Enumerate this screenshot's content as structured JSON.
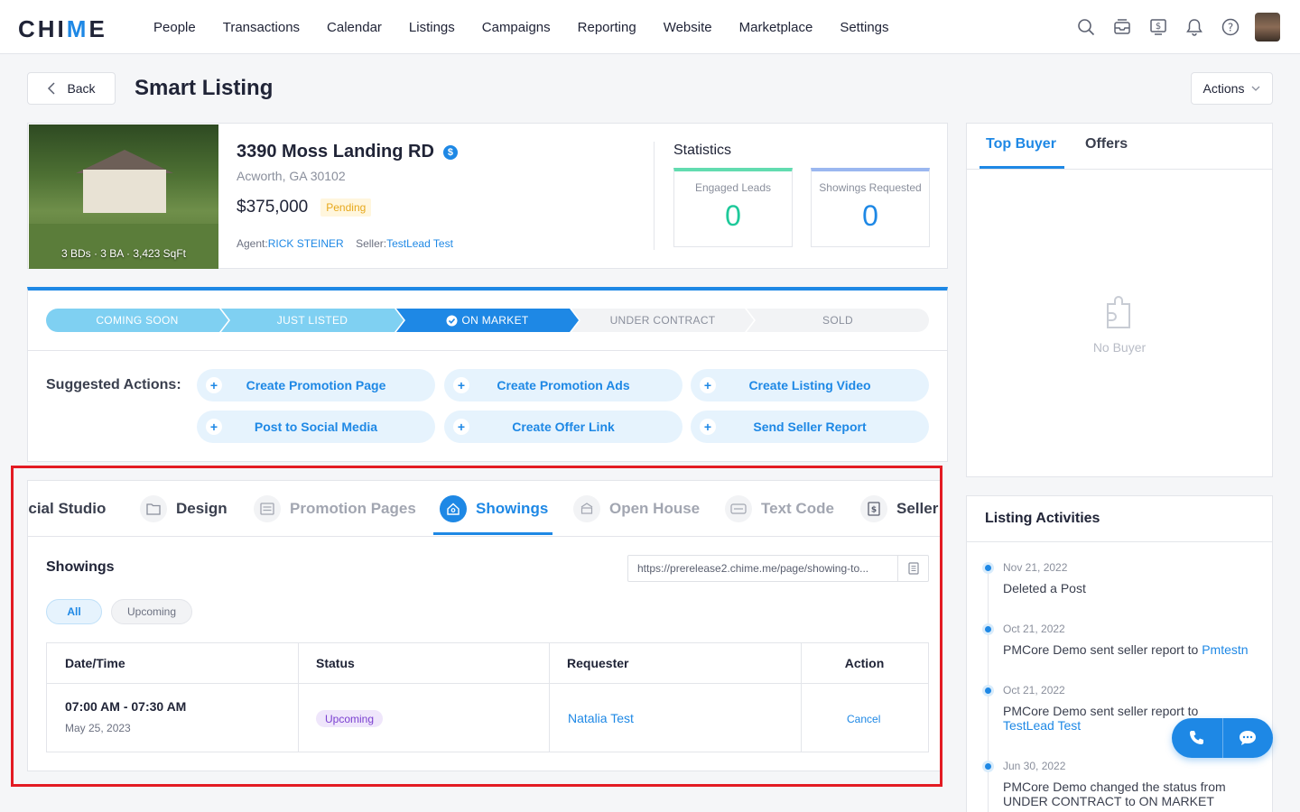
{
  "brand": {
    "logo_text_a": "CHI",
    "logo_text_b": "M",
    "logo_text_c": "E",
    "accent": "#1e88e5"
  },
  "nav": {
    "items": [
      "People",
      "Transactions",
      "Calendar",
      "Listings",
      "Campaigns",
      "Reporting",
      "Website",
      "Marketplace",
      "Settings"
    ],
    "icons": [
      "search-icon",
      "inbox-icon",
      "billing-icon",
      "bell-icon",
      "help-icon"
    ]
  },
  "header": {
    "back_label": "Back",
    "title": "Smart Listing",
    "actions_label": "Actions"
  },
  "listing": {
    "photo_caption": "3 BDs · 3 BA · 3,423 SqFt",
    "address": "3390 Moss Landing RD",
    "city": "Acworth, GA 30102",
    "price": "$375,000",
    "status": "Pending",
    "agent_label": "Agent:",
    "agent_name": "RICK STEINER",
    "seller_label": "Seller:",
    "seller_name": "TestLead Test"
  },
  "statistics": {
    "title": "Statistics",
    "engaged_label": "Engaged Leads",
    "engaged_value": "0",
    "showings_label": "Showings Requested",
    "showings_value": "0"
  },
  "pipeline": {
    "stages": [
      "COMING SOON",
      "JUST LISTED",
      "ON MARKET",
      "UNDER CONTRACT",
      "SOLD"
    ],
    "active_index": 2
  },
  "suggested": {
    "label": "Suggested Actions:",
    "actions": [
      "Create Promotion Page",
      "Create Promotion Ads",
      "Create Listing Video",
      "Post to Social Media",
      "Create Offer Link",
      "Send Seller Report"
    ]
  },
  "tabs": [
    "ocial Studio",
    "Design",
    "Promotion Pages",
    "Showings",
    "Open House",
    "Text Code",
    "Seller"
  ],
  "showings": {
    "title": "Showings",
    "url": "https://prerelease2.chime.me/page/showing-to...",
    "filters": [
      "All",
      "Upcoming"
    ],
    "columns": [
      "Date/Time",
      "Status",
      "Requester",
      "Action"
    ],
    "rows": [
      {
        "time": "07:00 AM - 07:30 AM",
        "date": "May 25, 2023",
        "status": "Upcoming",
        "requester": "Natalia Test",
        "action": "Cancel"
      }
    ]
  },
  "buyer_panel": {
    "tabs": [
      "Top Buyer",
      "Offers"
    ],
    "empty": "No Buyer"
  },
  "activities": {
    "title": "Listing Activities",
    "items": [
      {
        "date": "Nov 21, 2022",
        "text": "Deleted a Post",
        "link": ""
      },
      {
        "date": "Oct 21, 2022",
        "text": "PMCore Demo sent seller report to ",
        "link": "Pmtestn"
      },
      {
        "date": "Oct 21, 2022",
        "text": "PMCore Demo sent seller report to ",
        "link": "TestLead Test"
      },
      {
        "date": "Jun 30, 2022",
        "text": "PMCore Demo changed the status from UNDER CONTRACT to ON MARKET",
        "link": ""
      }
    ]
  }
}
